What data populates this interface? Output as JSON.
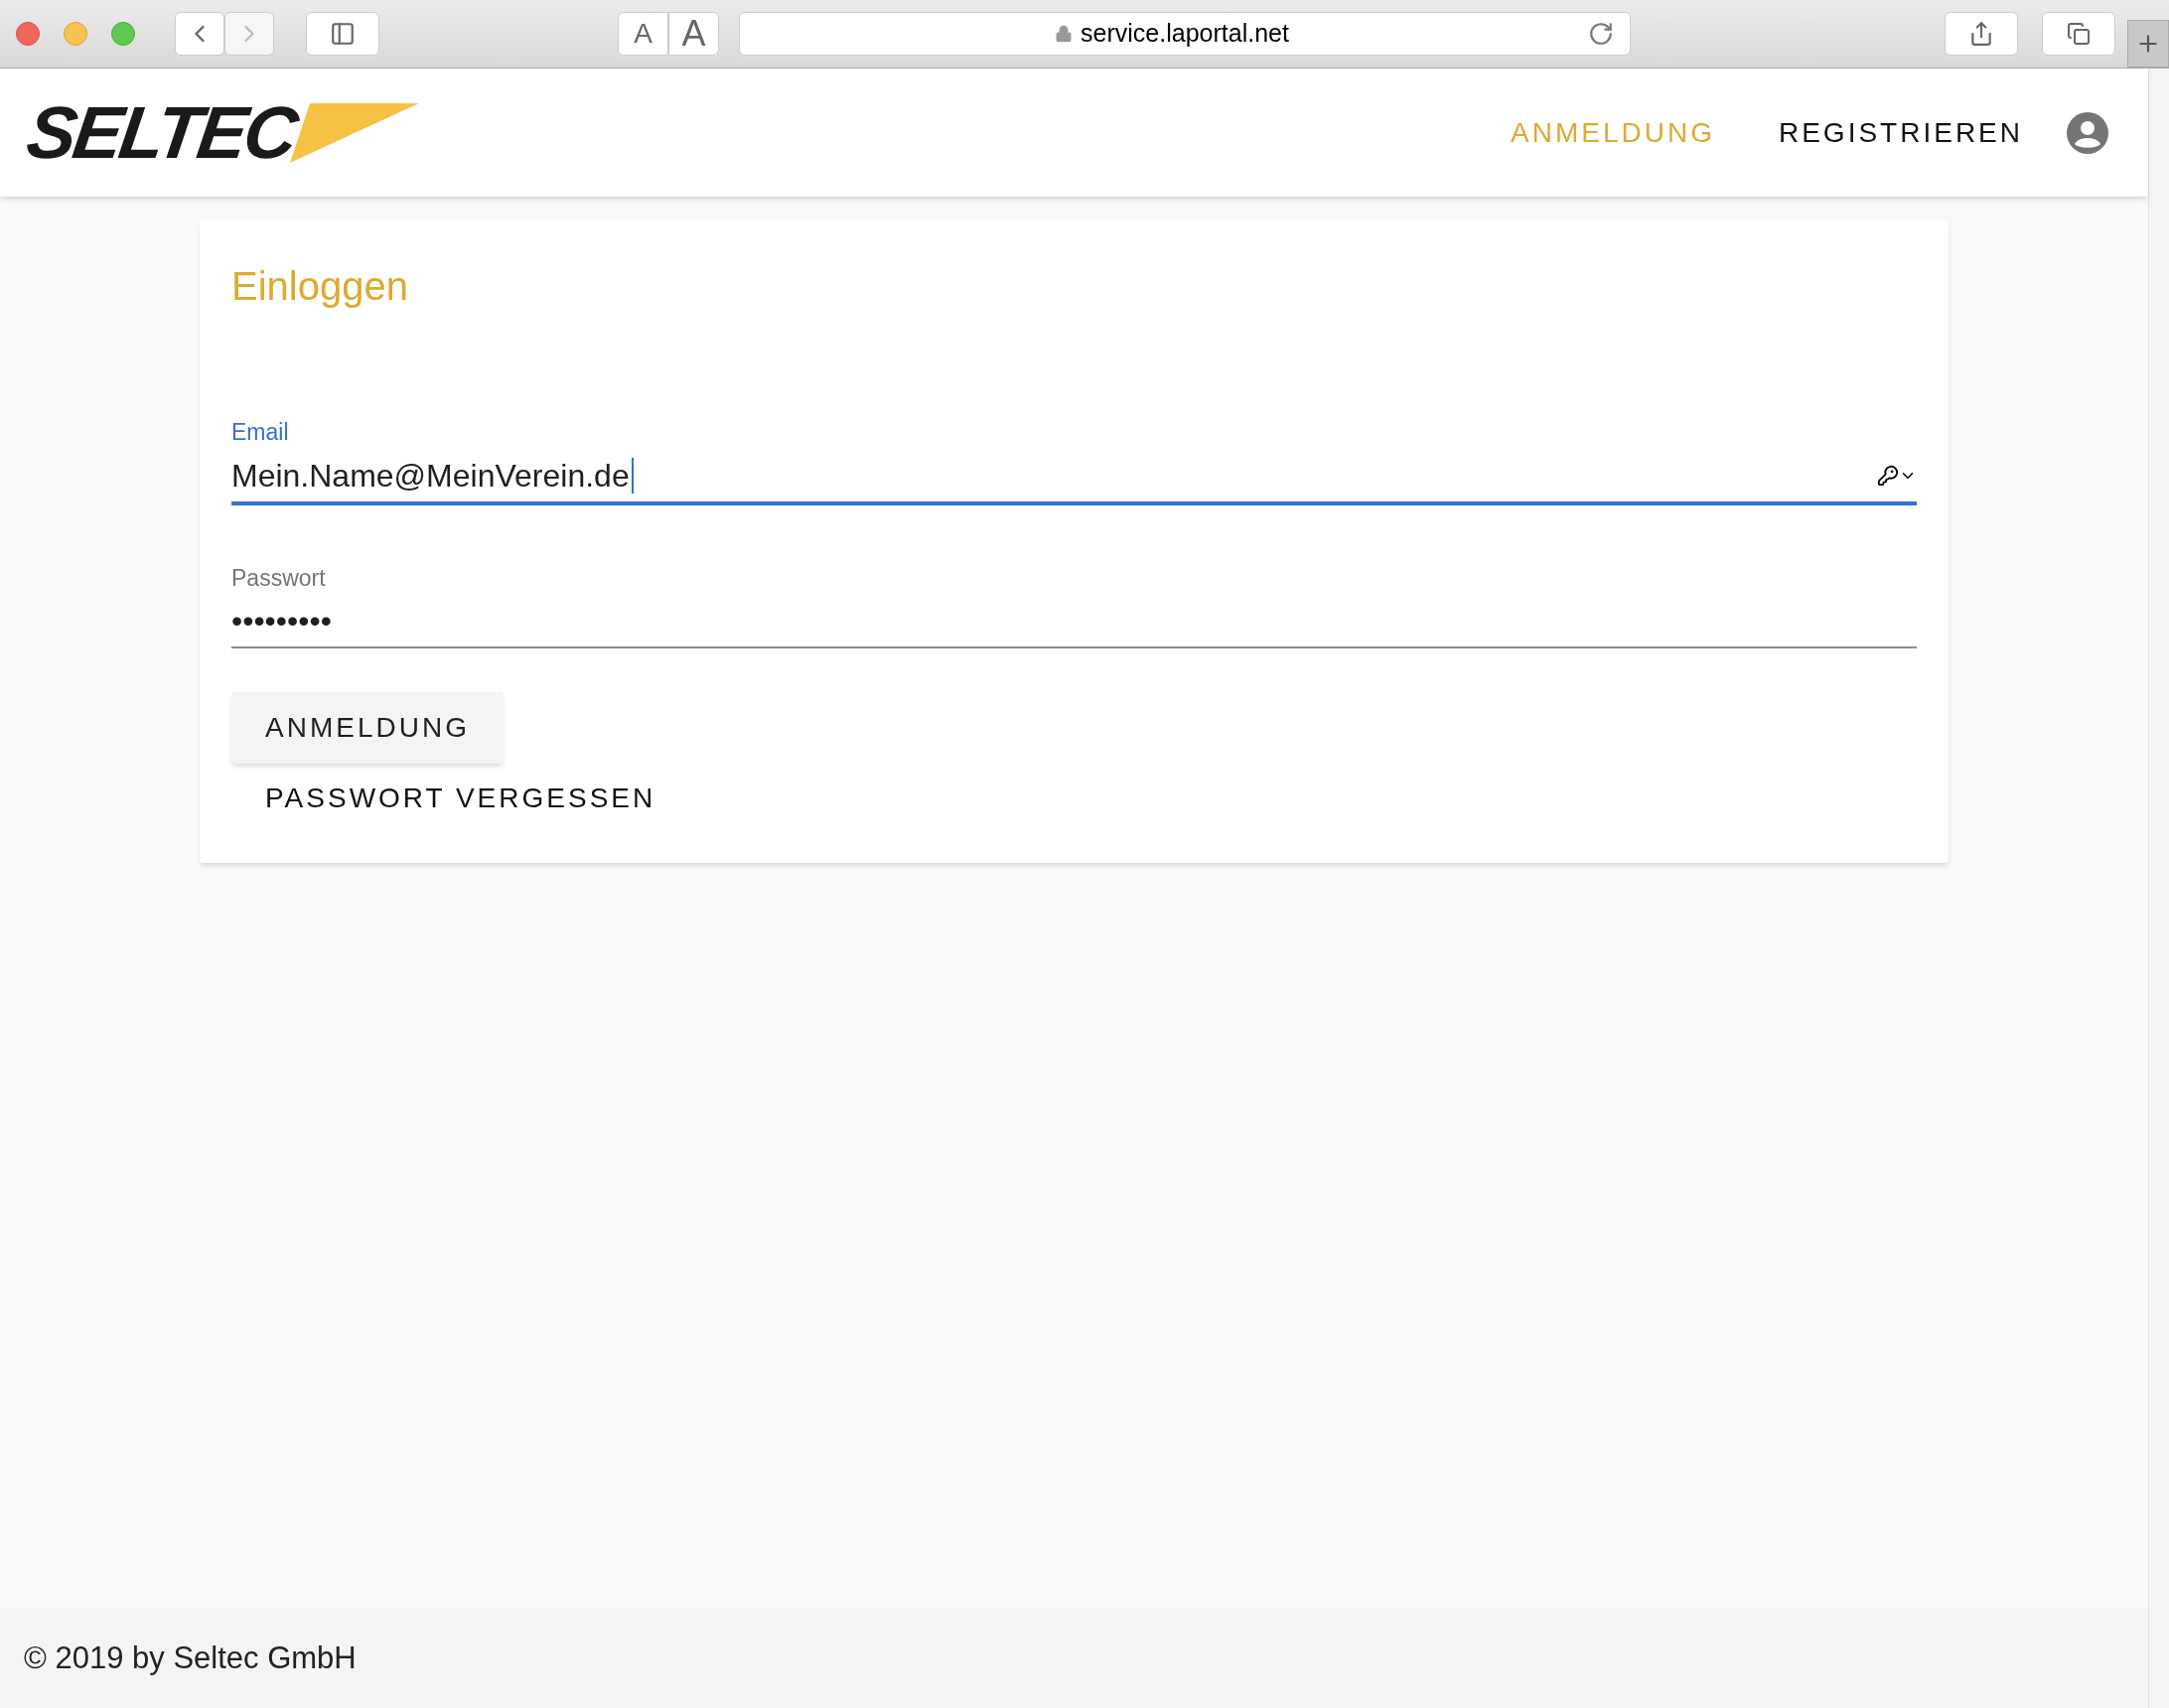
{
  "browser": {
    "url": "service.laportal.net",
    "text_size_small": "A",
    "text_size_large": "A"
  },
  "header": {
    "logo": "SELTEC",
    "nav": [
      {
        "label": "ANMELDUNG",
        "selected": true
      },
      {
        "label": "REGISTRIEREN",
        "selected": false
      }
    ]
  },
  "login": {
    "title": "Einloggen",
    "fields": [
      {
        "label": "Email",
        "value": "Mein.Name@MeinVerein.de",
        "focused": true
      },
      {
        "label": "Passwort",
        "value": "•••••••••",
        "focused": false
      }
    ],
    "submit": "ANMELDUNG",
    "forgot": "PASSWORT VERGESSEN"
  },
  "footer": "© 2019 by Seltec GmbH"
}
